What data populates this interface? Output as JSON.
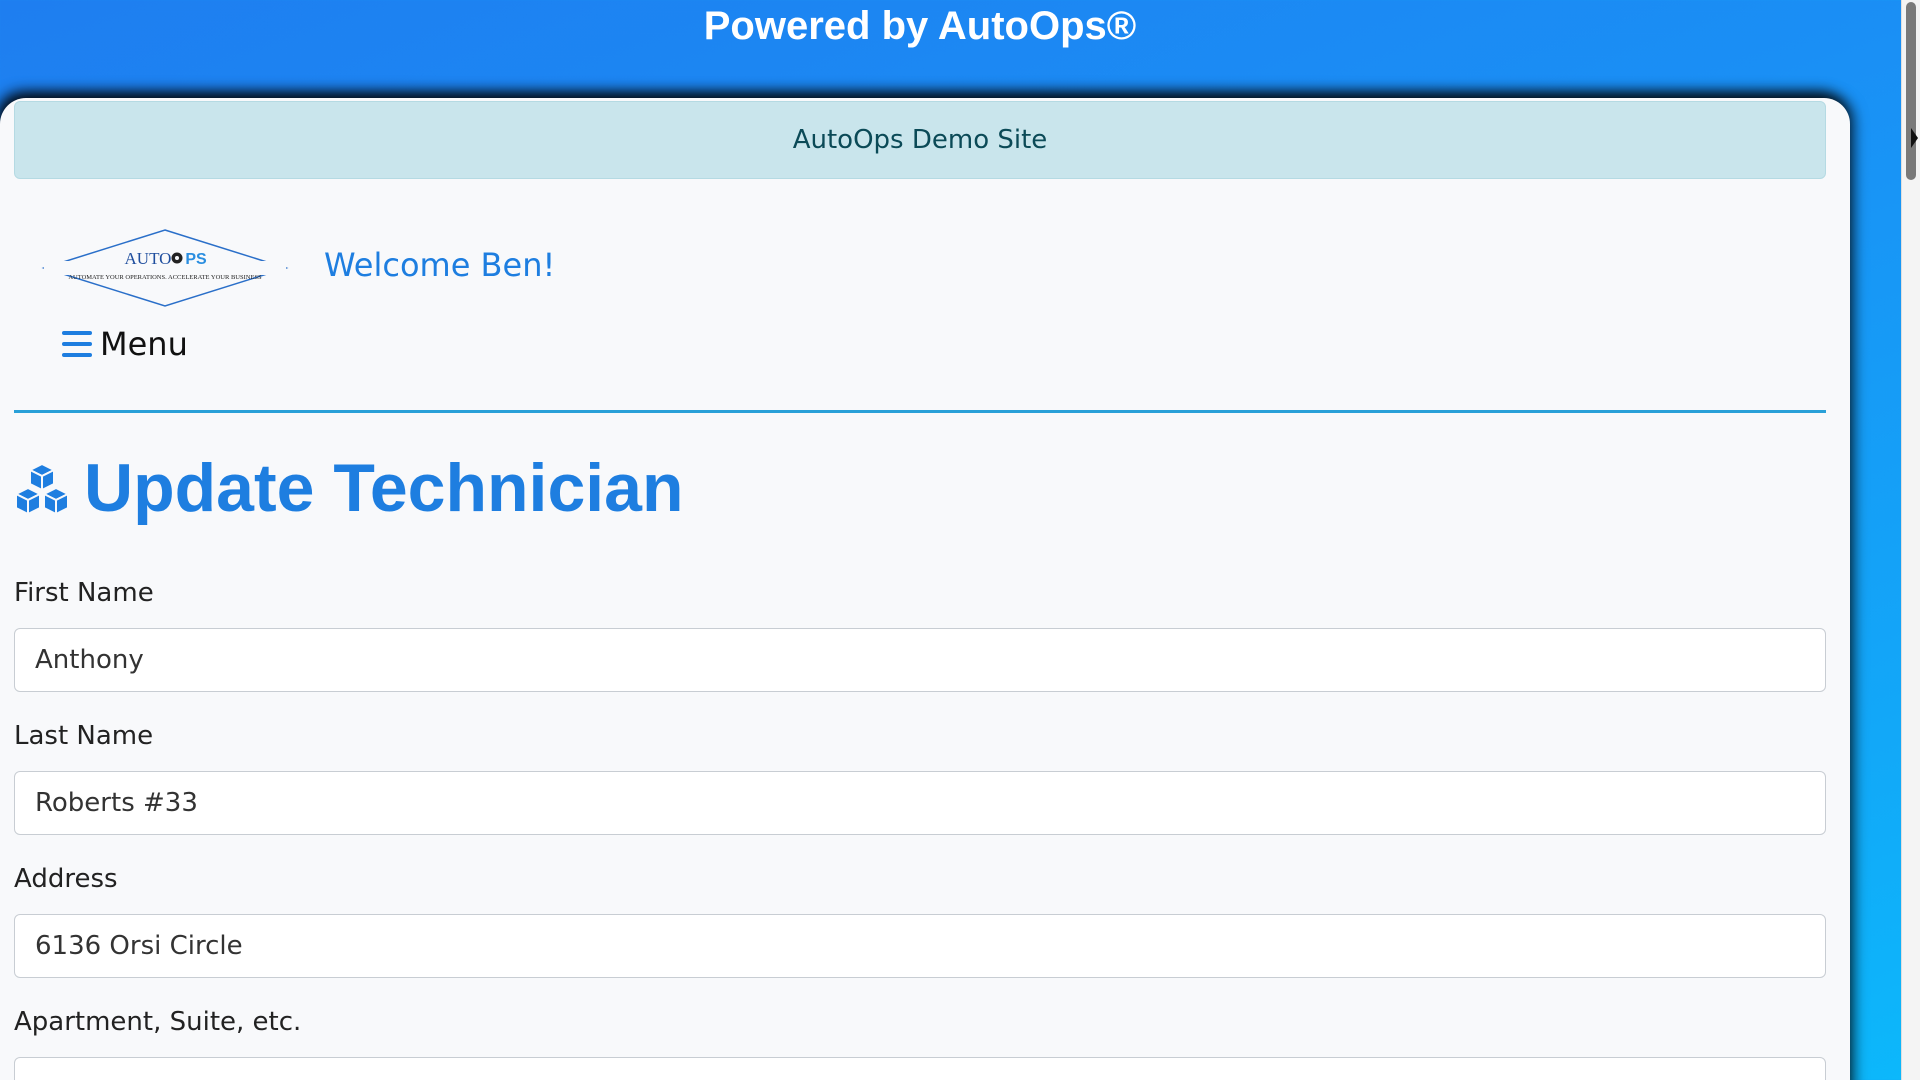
{
  "banner": {
    "text": "Powered by AutoOps®"
  },
  "site_alert": {
    "text": "AutoOps Demo Site"
  },
  "header": {
    "logo_name": "AUTOOPS",
    "logo_tagline": "AUTOMATE YOUR OPERATIONS. ACCELERATE YOUR BUSINESS",
    "welcome": "Welcome Ben!",
    "menu_label": "Menu",
    "menu_icon": "hamburger-icon"
  },
  "page": {
    "title": "Update Technician",
    "title_icon": "boxes-icon"
  },
  "form": {
    "first_name": {
      "label": "First Name",
      "value": "Anthony"
    },
    "last_name": {
      "label": "Last Name",
      "value": "Roberts #33"
    },
    "address": {
      "label": "Address",
      "value": "6136 Orsi Circle"
    },
    "apartment": {
      "label": "Apartment, Suite, etc.",
      "value": ""
    }
  },
  "colors": {
    "brand_blue": "#1e7ee0",
    "alert_bg": "#c9e5ec",
    "divider": "#2aa0d8"
  }
}
